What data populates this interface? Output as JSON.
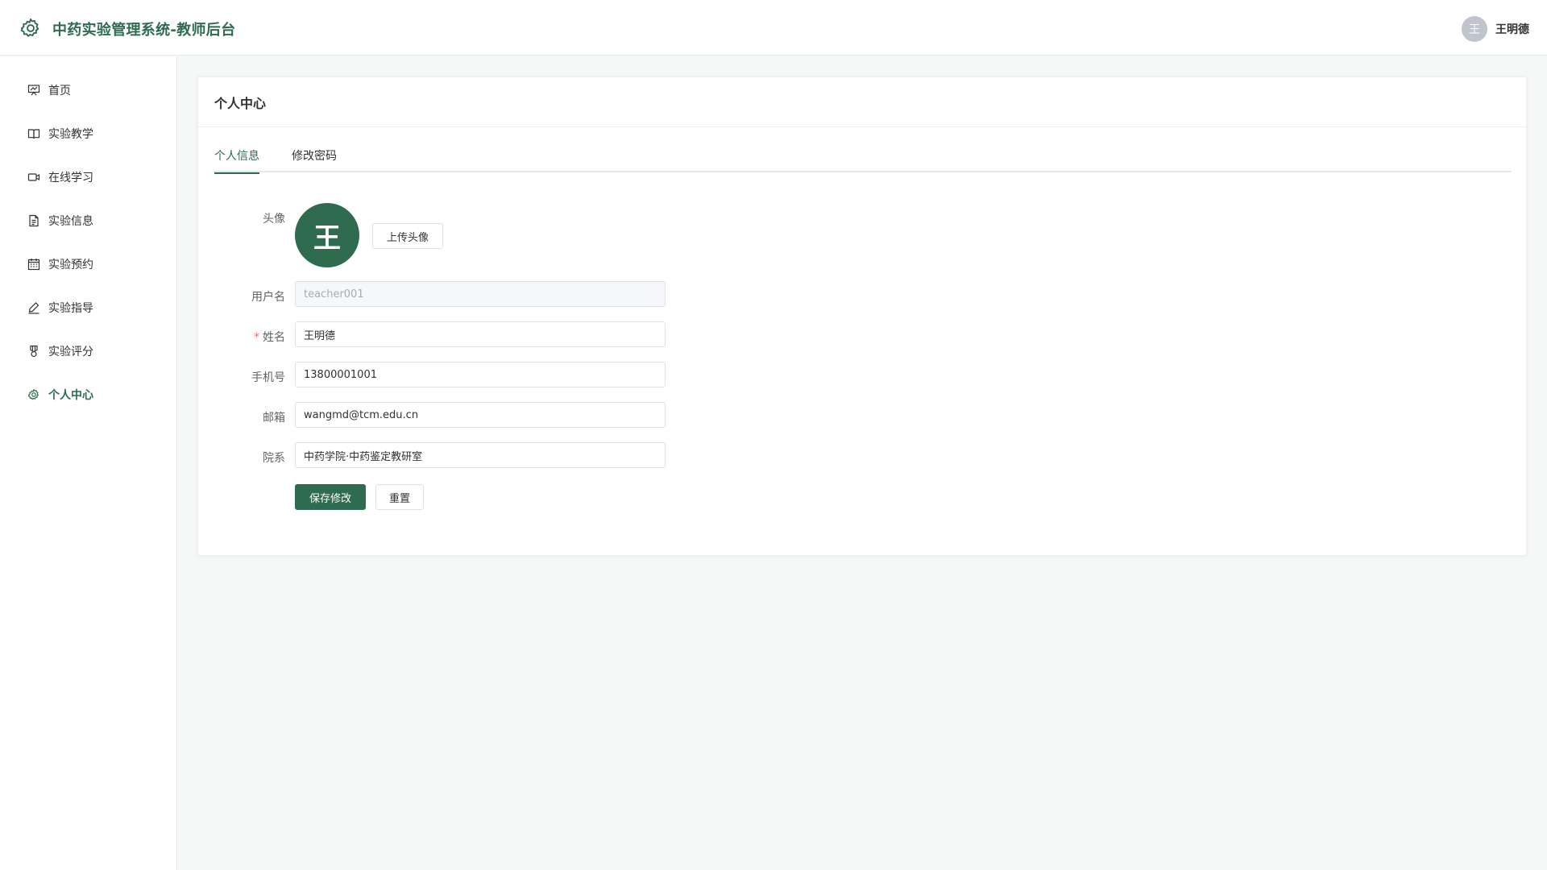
{
  "header": {
    "title": "中药实验管理系统-教师后台",
    "logo_icon": "gear-icon",
    "user_avatar_text": "王",
    "user_name": "王明德"
  },
  "sidebar": {
    "items": [
      {
        "label": "首页",
        "icon": "dashboard-icon",
        "active": false
      },
      {
        "label": "实验教学",
        "icon": "book-icon",
        "active": false
      },
      {
        "label": "在线学习",
        "icon": "video-icon",
        "active": false
      },
      {
        "label": "实验信息",
        "icon": "document-icon",
        "active": false
      },
      {
        "label": "实验预约",
        "icon": "calendar-icon",
        "active": false
      },
      {
        "label": "实验指导",
        "icon": "pen-icon",
        "active": false
      },
      {
        "label": "实验评分",
        "icon": "medal-icon",
        "active": false
      },
      {
        "label": "个人中心",
        "icon": "gear-icon",
        "active": true
      }
    ]
  },
  "main": {
    "title": "个人中心",
    "tabs": [
      {
        "label": "个人信息",
        "active": true
      },
      {
        "label": "修改密码",
        "active": false
      }
    ],
    "form": {
      "avatar_label": "头像",
      "avatar_text": "王",
      "upload_button": "上传头像",
      "username_label": "用户名",
      "username_value": "teacher001",
      "name_label": "姓名",
      "name_required_mark": "*",
      "name_value": "王明德",
      "phone_label": "手机号",
      "phone_value": "13800001001",
      "email_label": "邮箱",
      "email_value": "wangmd@tcm.edu.cn",
      "department_label": "院系",
      "department_value": "中药学院·中药鉴定教研室",
      "save_button": "保存修改",
      "reset_button": "重置"
    }
  },
  "colors": {
    "primary": "#2e6b4f",
    "required": "#f56c6c",
    "border": "#dcdfe6"
  }
}
